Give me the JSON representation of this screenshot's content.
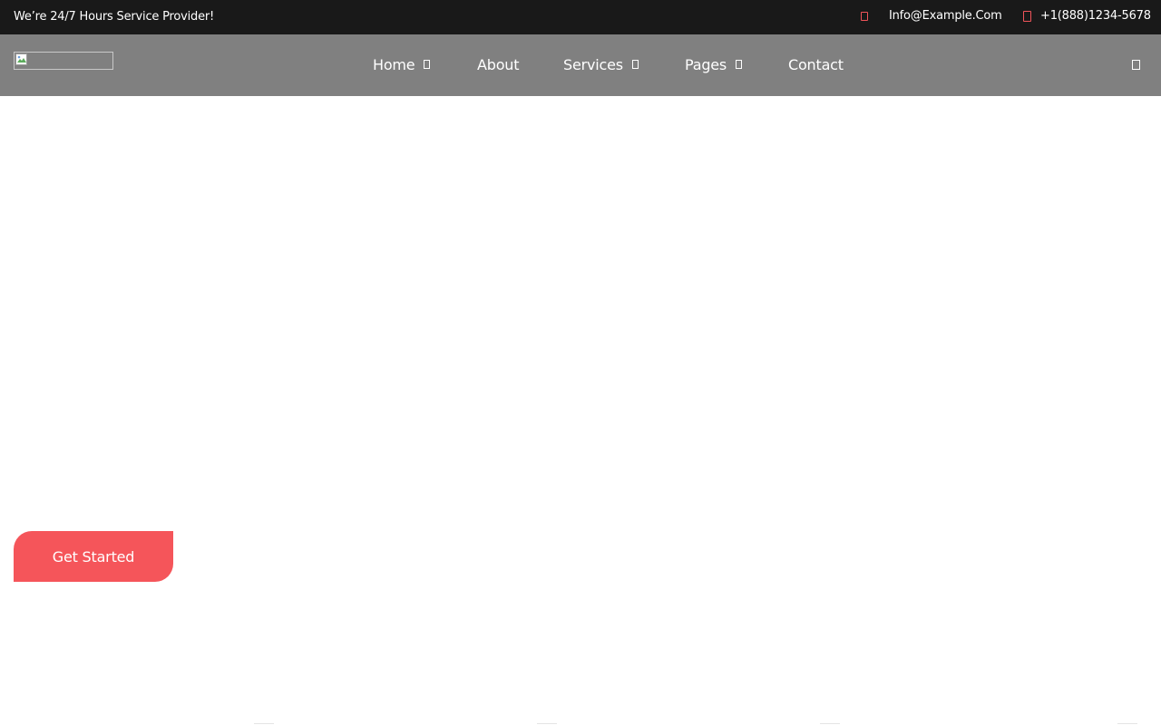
{
  "topbar": {
    "tagline": "We’re 24/7 Hours Service Provider!",
    "email": {
      "icon": "envelope-icon",
      "text": "Info@Example.Com"
    },
    "phone": {
      "icon": "phone-icon",
      "text": "+1(888)1234-5678"
    }
  },
  "header": {
    "logo_alt": "logo",
    "nav": [
      {
        "label": "Home",
        "has_dropdown": true
      },
      {
        "label": "About",
        "has_dropdown": false
      },
      {
        "label": "Services",
        "has_dropdown": true
      },
      {
        "label": "Pages",
        "has_dropdown": true
      },
      {
        "label": "Contact",
        "has_dropdown": false
      }
    ],
    "search_icon": "search-icon"
  },
  "hero": {
    "cta_label": "Get Started"
  },
  "colors": {
    "topbar_bg": "#191919",
    "navbar_bg": "#808080",
    "accent": "#f5555a"
  }
}
